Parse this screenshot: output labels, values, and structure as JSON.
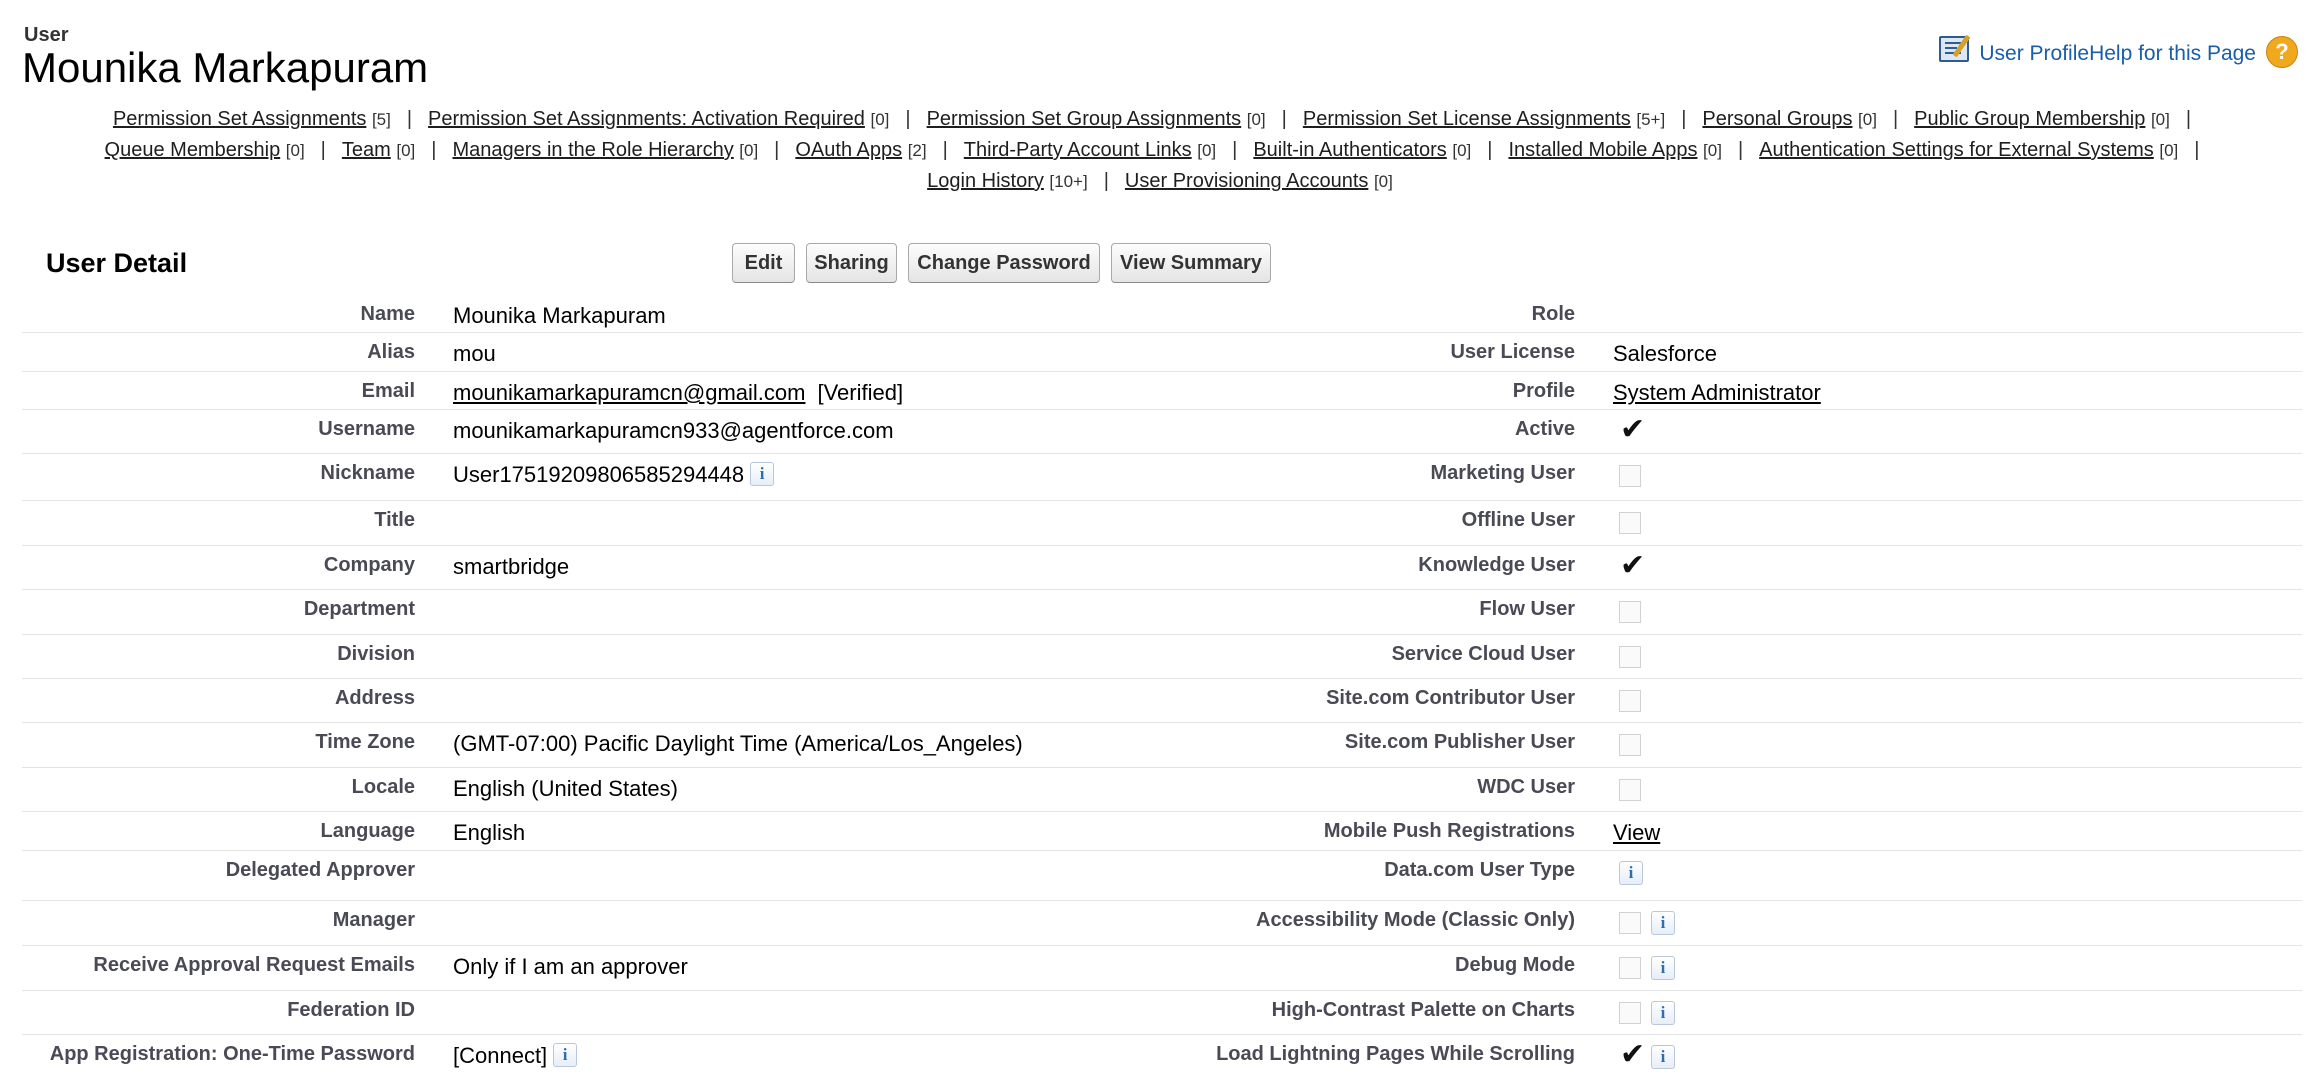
{
  "header": {
    "page_type": "User",
    "title": "Mounika Markapuram",
    "user_profile_link": "User Profile",
    "help_link": "Help for this Page"
  },
  "related_links": [
    [
      {
        "label": "Permission Set Assignments",
        "count": "[5]"
      },
      {
        "label": "Permission Set Assignments: Activation Required",
        "count": "[0]"
      },
      {
        "label": "Permission Set Group Assignments",
        "count": "[0]"
      },
      {
        "label": "Permission Set License Assignments",
        "count": "[5+]"
      },
      {
        "label": "Personal Groups",
        "count": "[0]"
      },
      {
        "label": "Public Group Membership",
        "count": "[0]"
      }
    ],
    [
      {
        "label": "Queue Membership",
        "count": "[0]"
      },
      {
        "label": "Team",
        "count": "[0]"
      },
      {
        "label": "Managers in the Role Hierarchy",
        "count": "[0]"
      },
      {
        "label": "OAuth Apps",
        "count": "[2]"
      },
      {
        "label": "Third-Party Account Links",
        "count": "[0]"
      },
      {
        "label": "Built-in Authenticators",
        "count": "[0]"
      },
      {
        "label": "Installed Mobile Apps",
        "count": "[0]"
      },
      {
        "label": "Authentication Settings for External Systems",
        "count": "[0]"
      }
    ],
    [
      {
        "label": "Login History",
        "count": "[10+]"
      },
      {
        "label": "User Provisioning Accounts",
        "count": "[0]"
      }
    ]
  ],
  "separator": "|",
  "section": {
    "title": "User Detail",
    "buttons": [
      "Edit",
      "Sharing",
      "Change Password",
      "View Summary"
    ]
  },
  "info_glyph": "i",
  "check_glyph": "✔",
  "fields": [
    {
      "label": "Name",
      "value": "Mounika Markapuram",
      "label2": "Role",
      "type2": "text",
      "value2": ""
    },
    {
      "label": "Alias",
      "value": "mou",
      "label2": "User License",
      "type2": "text",
      "value2": "Salesforce"
    },
    {
      "label": "Email",
      "value": "mounikamarkapuramcn@gmail.com",
      "link": true,
      "suffix": "[Verified]",
      "label2": "Profile",
      "type2": "link",
      "value2": "System Administrator"
    },
    {
      "label": "Username",
      "value": "mounikamarkapuramcn933@agentforce.com",
      "label2": "Active",
      "type2": "check",
      "checked2": true
    },
    {
      "label": "Nickname",
      "value": "User17519209806585294448",
      "info": true,
      "label2": "Marketing User",
      "type2": "check",
      "checked2": false
    },
    {
      "label": "Title",
      "value": "",
      "label2": "Offline User",
      "type2": "check",
      "checked2": false
    },
    {
      "label": "Company",
      "value": "smartbridge",
      "label2": "Knowledge User",
      "type2": "check",
      "checked2": true
    },
    {
      "label": "Department",
      "value": "",
      "label2": "Flow User",
      "type2": "check",
      "checked2": false
    },
    {
      "label": "Division",
      "value": "",
      "label2": "Service Cloud User",
      "type2": "check",
      "checked2": false
    },
    {
      "label": "Address",
      "value": "",
      "label2": "Site.com Contributor User",
      "type2": "check",
      "checked2": false
    },
    {
      "label": "Time Zone",
      "value": "(GMT-07:00) Pacific Daylight Time (America/Los_Angeles)",
      "label2": "Site.com Publisher User",
      "type2": "check",
      "checked2": false
    },
    {
      "label": "Locale",
      "value": "English (United States)",
      "label2": "WDC User",
      "type2": "check",
      "checked2": false
    },
    {
      "label": "Language",
      "value": "English",
      "label2": "Mobile Push Registrations",
      "type2": "link",
      "value2": "View"
    },
    {
      "label": "Delegated Approver",
      "value": "",
      "label2": "Data.com User Type",
      "type2": "info"
    },
    {
      "label": "Manager",
      "value": "",
      "label2": "Accessibility Mode (Classic Only)",
      "type2": "check",
      "checked2": false,
      "info2": true
    },
    {
      "label": "Receive Approval Request Emails",
      "value": "Only if I am an approver",
      "label2": "Debug Mode",
      "type2": "check",
      "checked2": false,
      "info2": true
    },
    {
      "label": "Federation ID",
      "value": "",
      "label2": "High-Contrast Palette on Charts",
      "type2": "check",
      "checked2": false,
      "info2": true
    },
    {
      "label": "App Registration: One-Time Password",
      "value": "[Connect]",
      "info": true,
      "label2": "Load Lightning Pages While Scrolling",
      "type2": "check",
      "checked2": true,
      "info2": true
    }
  ]
}
